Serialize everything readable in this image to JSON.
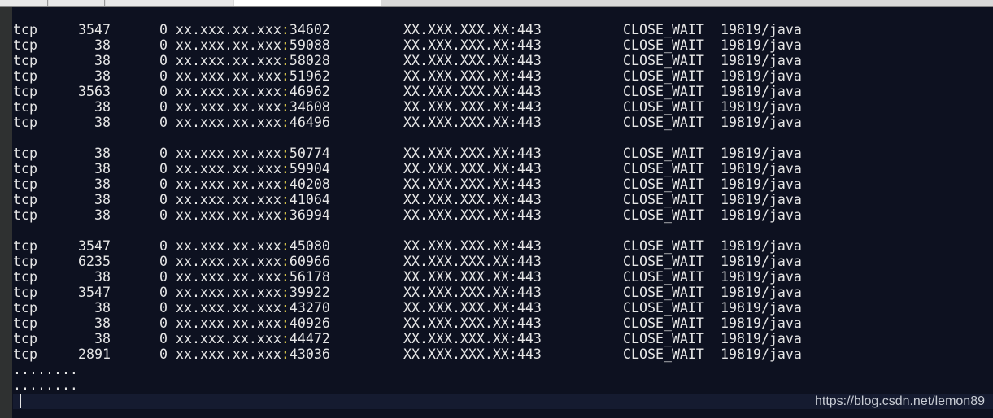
{
  "terminal": {
    "groups": [
      [
        {
          "proto": "tcp",
          "recv_q": "3547",
          "send_q": "0",
          "local_host": "xx.xxx.xx.xxx",
          "local_port": "34602",
          "remote": "XX.XXX.XXX.XX:443",
          "state": "CLOSE_WAIT",
          "pid": "19819/java"
        },
        {
          "proto": "tcp",
          "recv_q": "38",
          "send_q": "0",
          "local_host": "xx.xxx.xx.xxx",
          "local_port": "59088",
          "remote": "XX.XXX.XXX.XX:443",
          "state": "CLOSE_WAIT",
          "pid": "19819/java"
        },
        {
          "proto": "tcp",
          "recv_q": "38",
          "send_q": "0",
          "local_host": "xx.xxx.xx.xxx",
          "local_port": "58028",
          "remote": "XX.XXX.XXX.XX:443",
          "state": "CLOSE_WAIT",
          "pid": "19819/java"
        },
        {
          "proto": "tcp",
          "recv_q": "38",
          "send_q": "0",
          "local_host": "xx.xxx.xx.xxx",
          "local_port": "51962",
          "remote": "XX.XXX.XXX.XX:443",
          "state": "CLOSE_WAIT",
          "pid": "19819/java"
        },
        {
          "proto": "tcp",
          "recv_q": "3563",
          "send_q": "0",
          "local_host": "xx.xxx.xx.xxx",
          "local_port": "46962",
          "remote": "XX.XXX.XXX.XX:443",
          "state": "CLOSE_WAIT",
          "pid": "19819/java"
        },
        {
          "proto": "tcp",
          "recv_q": "38",
          "send_q": "0",
          "local_host": "xx.xxx.xx.xxx",
          "local_port": "34608",
          "remote": "XX.XXX.XXX.XX:443",
          "state": "CLOSE_WAIT",
          "pid": "19819/java"
        },
        {
          "proto": "tcp",
          "recv_q": "38",
          "send_q": "0",
          "local_host": "xx.xxx.xx.xxx",
          "local_port": "46496",
          "remote": "XX.XXX.XXX.XX:443",
          "state": "CLOSE_WAIT",
          "pid": "19819/java"
        }
      ],
      [
        {
          "proto": "tcp",
          "recv_q": "38",
          "send_q": "0",
          "local_host": "xx.xxx.xx.xxx",
          "local_port": "50774",
          "remote": "XX.XXX.XXX.XX:443",
          "state": "CLOSE_WAIT",
          "pid": "19819/java"
        },
        {
          "proto": "tcp",
          "recv_q": "38",
          "send_q": "0",
          "local_host": "xx.xxx.xx.xxx",
          "local_port": "59904",
          "remote": "XX.XXX.XXX.XX:443",
          "state": "CLOSE_WAIT",
          "pid": "19819/java"
        },
        {
          "proto": "tcp",
          "recv_q": "38",
          "send_q": "0",
          "local_host": "xx.xxx.xx.xxx",
          "local_port": "40208",
          "remote": "XX.XXX.XXX.XX:443",
          "state": "CLOSE_WAIT",
          "pid": "19819/java"
        },
        {
          "proto": "tcp",
          "recv_q": "38",
          "send_q": "0",
          "local_host": "xx.xxx.xx.xxx",
          "local_port": "41064",
          "remote": "XX.XXX.XXX.XX:443",
          "state": "CLOSE_WAIT",
          "pid": "19819/java"
        },
        {
          "proto": "tcp",
          "recv_q": "38",
          "send_q": "0",
          "local_host": "xx.xxx.xx.xxx",
          "local_port": "36994",
          "remote": "XX.XXX.XXX.XX:443",
          "state": "CLOSE_WAIT",
          "pid": "19819/java"
        }
      ],
      [
        {
          "proto": "tcp",
          "recv_q": "3547",
          "send_q": "0",
          "local_host": "xx.xxx.xx.xxx",
          "local_port": "45080",
          "remote": "XX.XXX.XXX.XX:443",
          "state": "CLOSE_WAIT",
          "pid": "19819/java"
        },
        {
          "proto": "tcp",
          "recv_q": "6235",
          "send_q": "0",
          "local_host": "xx.xxx.xx.xxx",
          "local_port": "60966",
          "remote": "XX.XXX.XXX.XX:443",
          "state": "CLOSE_WAIT",
          "pid": "19819/java"
        },
        {
          "proto": "tcp",
          "recv_q": "38",
          "send_q": "0",
          "local_host": "xx.xxx.xx.xxx",
          "local_port": "56178",
          "remote": "XX.XXX.XXX.XX:443",
          "state": "CLOSE_WAIT",
          "pid": "19819/java"
        },
        {
          "proto": "tcp",
          "recv_q": "3547",
          "send_q": "0",
          "local_host": "xx.xxx.xx.xxx",
          "local_port": "39922",
          "remote": "XX.XXX.XXX.XX:443",
          "state": "CLOSE_WAIT",
          "pid": "19819/java"
        },
        {
          "proto": "tcp",
          "recv_q": "38",
          "send_q": "0",
          "local_host": "xx.xxx.xx.xxx",
          "local_port": "43270",
          "remote": "XX.XXX.XXX.XX:443",
          "state": "CLOSE_WAIT",
          "pid": "19819/java"
        },
        {
          "proto": "tcp",
          "recv_q": "38",
          "send_q": "0",
          "local_host": "xx.xxx.xx.xxx",
          "local_port": "40926",
          "remote": "XX.XXX.XXX.XX:443",
          "state": "CLOSE_WAIT",
          "pid": "19819/java"
        },
        {
          "proto": "tcp",
          "recv_q": "38",
          "send_q": "0",
          "local_host": "xx.xxx.xx.xxx",
          "local_port": "44472",
          "remote": "XX.XXX.XXX.XX:443",
          "state": "CLOSE_WAIT",
          "pid": "19819/java"
        },
        {
          "proto": "tcp",
          "recv_q": "2891",
          "send_q": "0",
          "local_host": "xx.xxx.xx.xxx",
          "local_port": "43036",
          "remote": "XX.XXX.XXX.XX:443",
          "state": "CLOSE_WAIT",
          "pid": "19819/java"
        }
      ]
    ],
    "ellipsis_lines": [
      "........",
      "........"
    ]
  },
  "watermark": "https://blog.csdn.net/lemon89",
  "colors": {
    "background": "#0d1120",
    "text": "#e6e6e6",
    "colon_highlight": "#e8d44d"
  }
}
